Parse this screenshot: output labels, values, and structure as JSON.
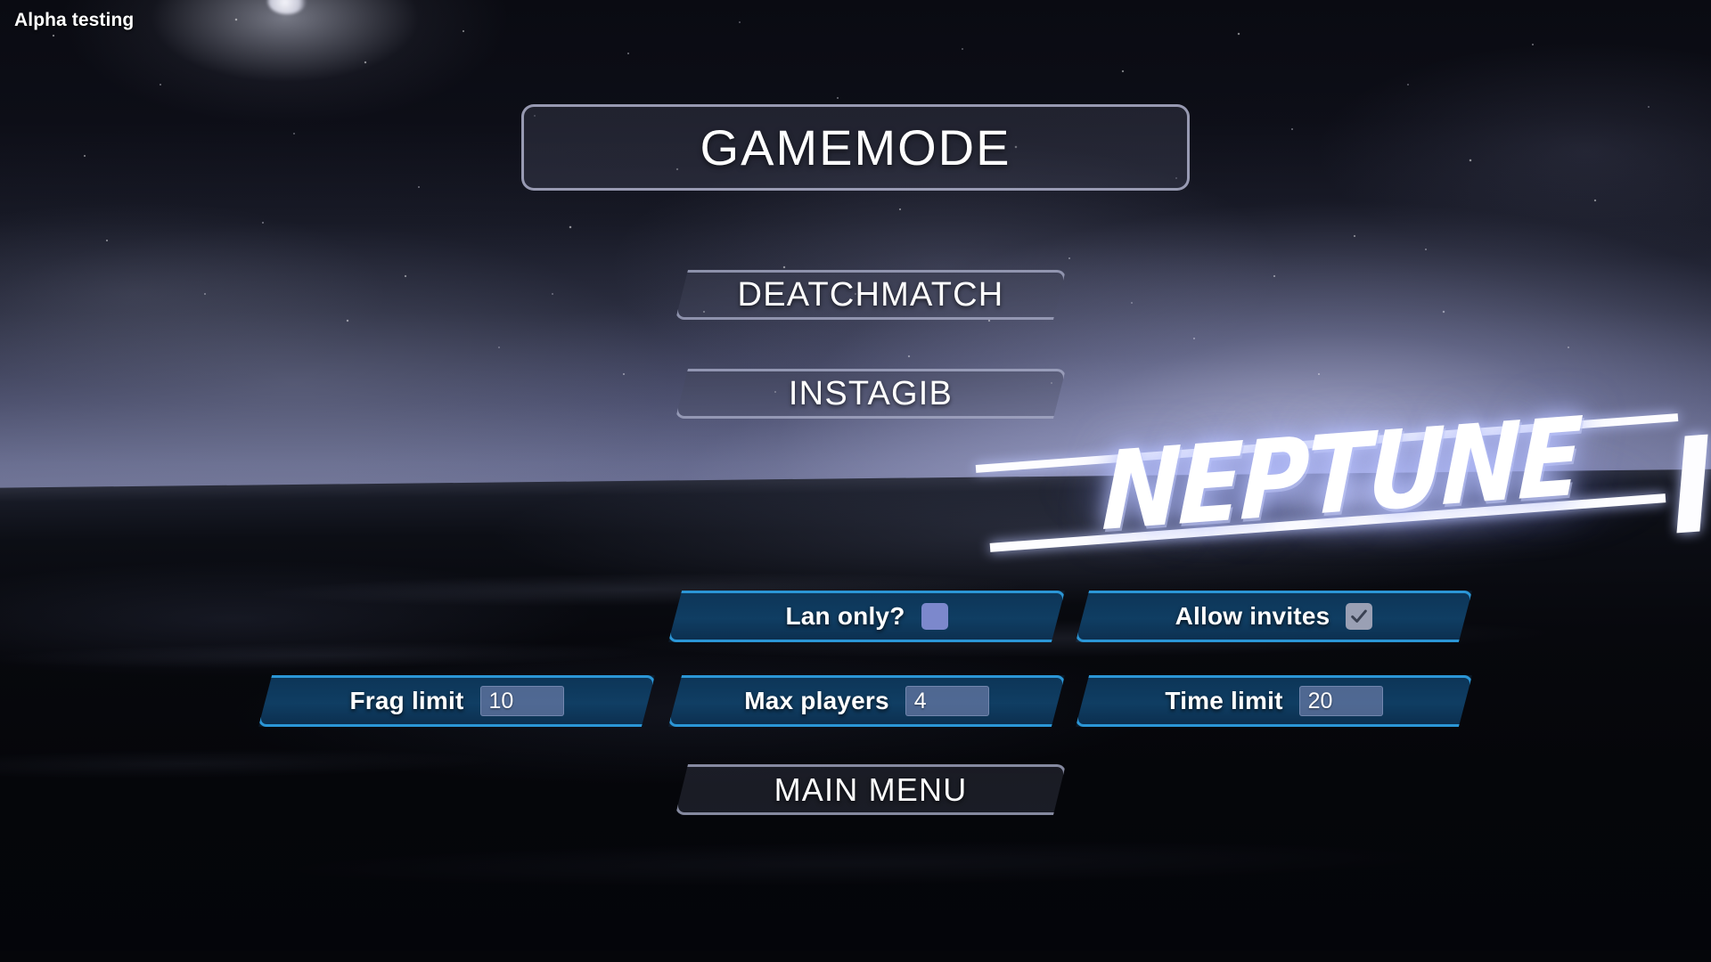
{
  "overlay": {
    "build_label": "Alpha testing"
  },
  "branding": {
    "logo_text": "NEPTUNE"
  },
  "menu": {
    "title": "GAMEMODE",
    "gamemodes": [
      {
        "label": "DEATCHMATCH"
      },
      {
        "label": "INSTAGIB"
      }
    ],
    "back_label": "MAIN MENU"
  },
  "settings": {
    "toggles": [
      {
        "label": "Lan only?",
        "checked": false
      },
      {
        "label": "Allow invites",
        "checked": true
      }
    ],
    "fields": [
      {
        "label": "Frag limit",
        "value": "10"
      },
      {
        "label": "Max players",
        "value": "4"
      },
      {
        "label": "Time limit",
        "value": "20"
      }
    ]
  },
  "colors": {
    "option_border": "#2b96d6",
    "option_fill": "#0d385c",
    "panel_border": "#b5b8d2",
    "text": "#ffffff",
    "checkbox_unchecked": "#7c88cc",
    "checkbox_checked": "#9aa0b4"
  }
}
